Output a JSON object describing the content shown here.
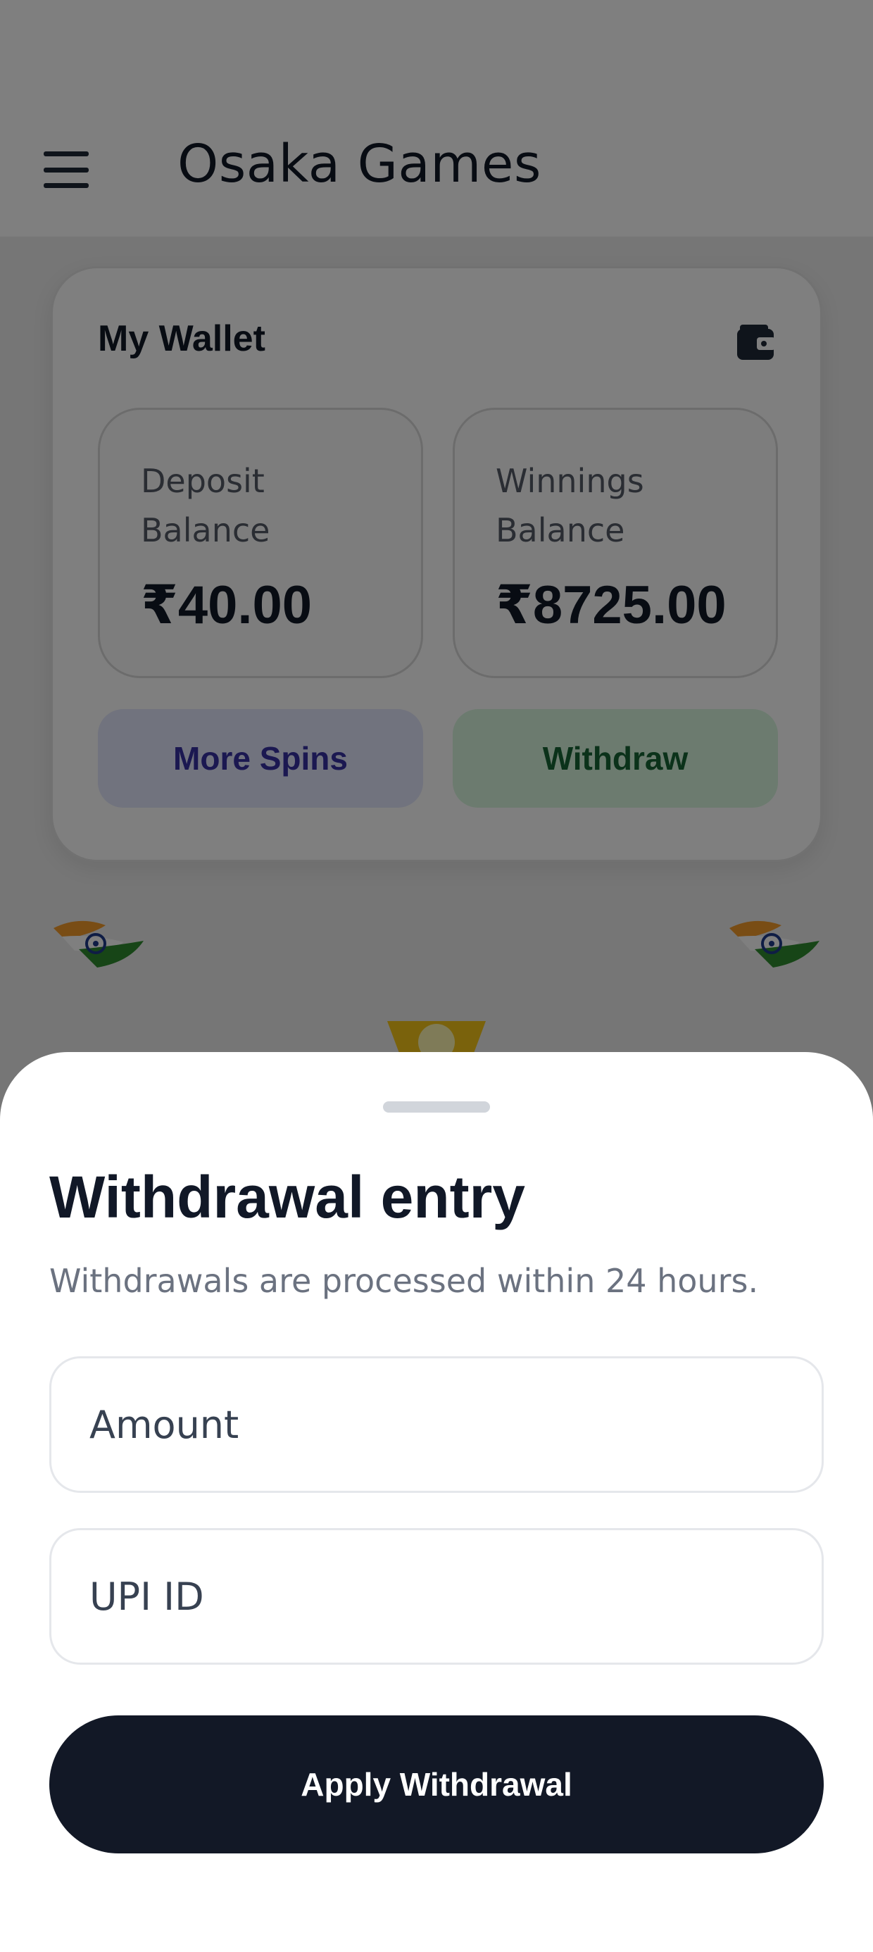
{
  "app": {
    "title": "Osaka Games"
  },
  "wallet": {
    "title": "My Wallet",
    "deposit_label": "Deposit Balance",
    "deposit_value": "₹40.00",
    "winnings_label": "Winnings Balance",
    "winnings_value": "₹8725.00",
    "more_spins_label": "More Spins",
    "withdraw_label": "Withdraw",
    "icon": "wallet-icon"
  },
  "decor": {
    "flag_icon": "india-flag-icon",
    "trophy_icon": "trophy-icon"
  },
  "sheet": {
    "title": "Withdrawal entry",
    "subtitle": "Withdrawals are processed within 24 hours.",
    "amount_placeholder": "Amount",
    "upi_placeholder": "UPI ID",
    "submit_label": "Apply Withdrawal"
  },
  "colors": {
    "primary_button": "#121826",
    "spins_bg": "#e3e6fc",
    "spins_text": "#3730a3",
    "withdraw_bg": "#d8f7de",
    "withdraw_text": "#166534",
    "scrim": "rgba(0,0,0,0.5)"
  }
}
